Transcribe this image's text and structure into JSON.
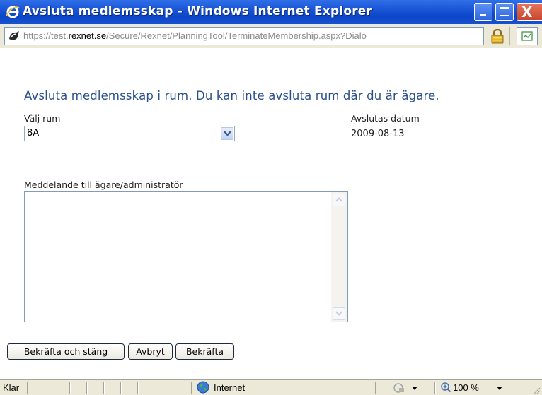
{
  "window": {
    "title": "Avsluta medlemsskap - Windows Internet Explorer",
    "buttons": {
      "minimize": "minimize",
      "maximize": "maximize",
      "close": "X"
    }
  },
  "address": {
    "url_prefix": "https://",
    "url_sub": "test.",
    "url_domain": "rexnet.se",
    "url_path": "/Secure/Rexnet/PlanningTool/TerminateMembership.aspx?Dialo"
  },
  "form": {
    "heading": "Avsluta medlemsskap i rum. Du kan inte avsluta rum där du är ägare.",
    "room_label": "Välj rum",
    "room_value": "8A",
    "date_label": "Avslutas datum",
    "date_value": "2009-08-13",
    "message_label": "Meddelande till ägare/administratör",
    "message_value": ""
  },
  "actions": {
    "confirm_close": "Bekräfta och stäng",
    "cancel": "Avbryt",
    "confirm": "Bekräfta"
  },
  "status": {
    "text": "Klar",
    "zone": "Internet",
    "zoom": "100 %"
  },
  "colors": {
    "titlebar": "#0c45c8",
    "heading": "#2a4f8f",
    "chrome": "#ece9d8"
  },
  "icons": [
    "ie-logo-icon",
    "page-icon",
    "lock-icon",
    "feed-icon",
    "globe-icon",
    "security-icon",
    "zoom-icon",
    "chevron-down-icon",
    "scroll-up-icon",
    "scroll-down-icon"
  ]
}
